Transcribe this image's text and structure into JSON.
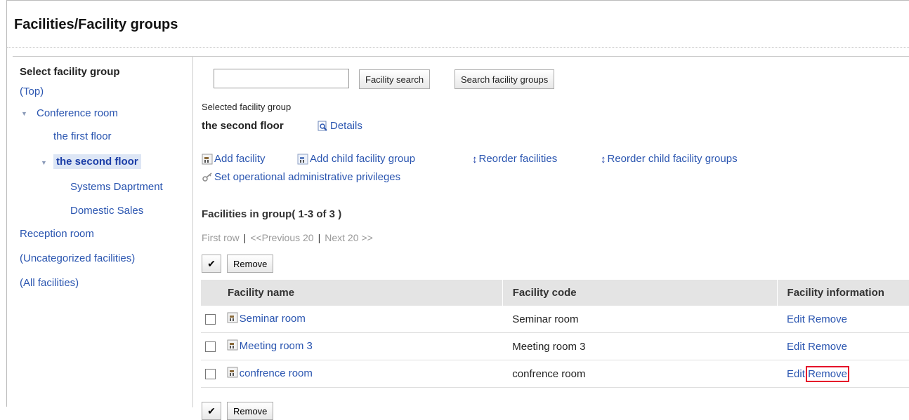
{
  "page_title": "Facilities/Facility groups",
  "sidebar": {
    "title": "Select facility group",
    "top": "(Top)",
    "conference_room": "Conference room",
    "first_floor": "the first floor",
    "second_floor": "the second floor",
    "systems": "Systems Daprtment",
    "domestic": "Domestic Sales",
    "reception": "Reception room",
    "uncategorized": "(Uncategorized facilities)",
    "all": "(All facilities)"
  },
  "search": {
    "value": "",
    "facility_search": "Facility search",
    "group_search": "Search facility groups"
  },
  "selected": {
    "label": "Selected facility group",
    "name": "the second floor",
    "details": "Details"
  },
  "actions": {
    "add_facility": "Add facility",
    "add_child": "Add child facility group",
    "reorder_facilities": "Reorder facilities",
    "reorder_groups": "Reorder child facility groups",
    "privileges": "Set operational administrative privileges"
  },
  "list": {
    "title": "Facilities in group( 1-3 of 3 )",
    "pager": {
      "first": "First row",
      "prev": "<<Previous 20",
      "next": "Next 20 >>"
    },
    "remove_button": "Remove",
    "check_icon": "checkmark-icon",
    "columns": [
      "Facility name",
      "Facility code",
      "Facility information"
    ],
    "rows": [
      {
        "name": "Seminar room",
        "code": "Seminar room",
        "edit": "Edit",
        "remove": "Remove"
      },
      {
        "name": "Meeting room 3",
        "code": "Meeting room 3",
        "edit": "Edit",
        "remove": "Remove"
      },
      {
        "name": "confrence room",
        "code": "confrence room",
        "edit": "Edit",
        "remove": "Remove"
      }
    ]
  },
  "colors": {
    "link": "#2a55b0",
    "highlight": "#e5132a",
    "header_bg": "#e4e4e4"
  }
}
